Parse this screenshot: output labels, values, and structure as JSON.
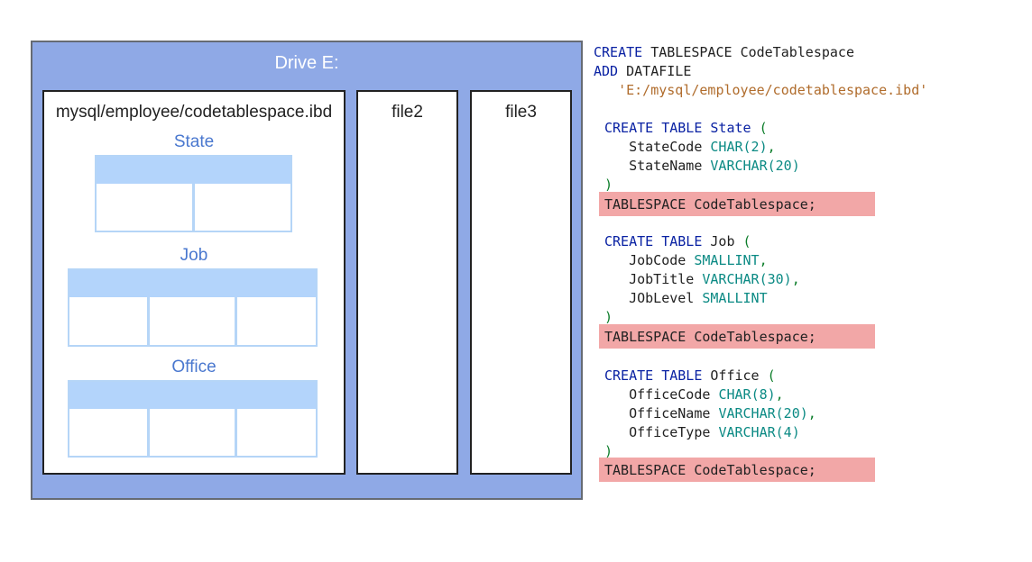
{
  "drive": {
    "title": "Drive E:",
    "files": [
      {
        "name": "mysql/employee/codetablespace.ibd",
        "tables": [
          {
            "name": "State",
            "columns": 2
          },
          {
            "name": "Job",
            "columns": 3
          },
          {
            "name": "Office",
            "columns": 3
          }
        ]
      },
      {
        "name": "file2"
      },
      {
        "name": "file3"
      }
    ]
  },
  "sql": {
    "create_tablespace": {
      "kw1": "CREATE",
      "kw2": "TABLESPACE",
      "name": "CodeTablespace",
      "kw3": "ADD",
      "kw4": "DATAFILE",
      "path": "'E:/mysql/employee/codetablespace.ibd'"
    },
    "tables": [
      {
        "kw_create": "CREATE",
        "kw_table": "TABLE",
        "name": "State",
        "open": "(",
        "columns": [
          {
            "name": "StateCode",
            "type": "CHAR",
            "arg": "(2)",
            "sep": ","
          },
          {
            "name": "StateName",
            "type": "VARCHAR",
            "arg": "(20)",
            "sep": ""
          }
        ],
        "close": ")",
        "suffix": "TABLESPACE CodeTablespace;"
      },
      {
        "kw_create": "CREATE",
        "kw_table": "TABLE",
        "name": "Job",
        "open": "(",
        "columns": [
          {
            "name": "JobCode",
            "type": "SMALLINT",
            "arg": "",
            "sep": ","
          },
          {
            "name": "JobTitle",
            "type": "VARCHAR",
            "arg": "(30)",
            "sep": ","
          },
          {
            "name": "JObLevel",
            "type": "SMALLINT",
            "arg": "",
            "sep": ""
          }
        ],
        "close": ")",
        "suffix": "TABLESPACE CodeTablespace;"
      },
      {
        "kw_create": "CREATE",
        "kw_table": "TABLE",
        "name": "Office",
        "open": "(",
        "columns": [
          {
            "name": "OfficeCode",
            "type": "CHAR",
            "arg": "(8)",
            "sep": ","
          },
          {
            "name": "OfficeName",
            "type": "VARCHAR",
            "arg": "(20)",
            "sep": ","
          },
          {
            "name": "OfficeType",
            "type": "VARCHAR",
            "arg": "(4)",
            "sep": ""
          }
        ],
        "close": ")",
        "suffix": "TABLESPACE CodeTablespace;"
      }
    ]
  },
  "colors": {
    "drive_bg": "#8fa9e6",
    "table_header": "#b3d4fb",
    "table_name": "#4a78cf",
    "highlight": "#f2a7a7",
    "keyword": "#0a22a3",
    "type": "#0b8a84",
    "string": "#b06c2c"
  }
}
